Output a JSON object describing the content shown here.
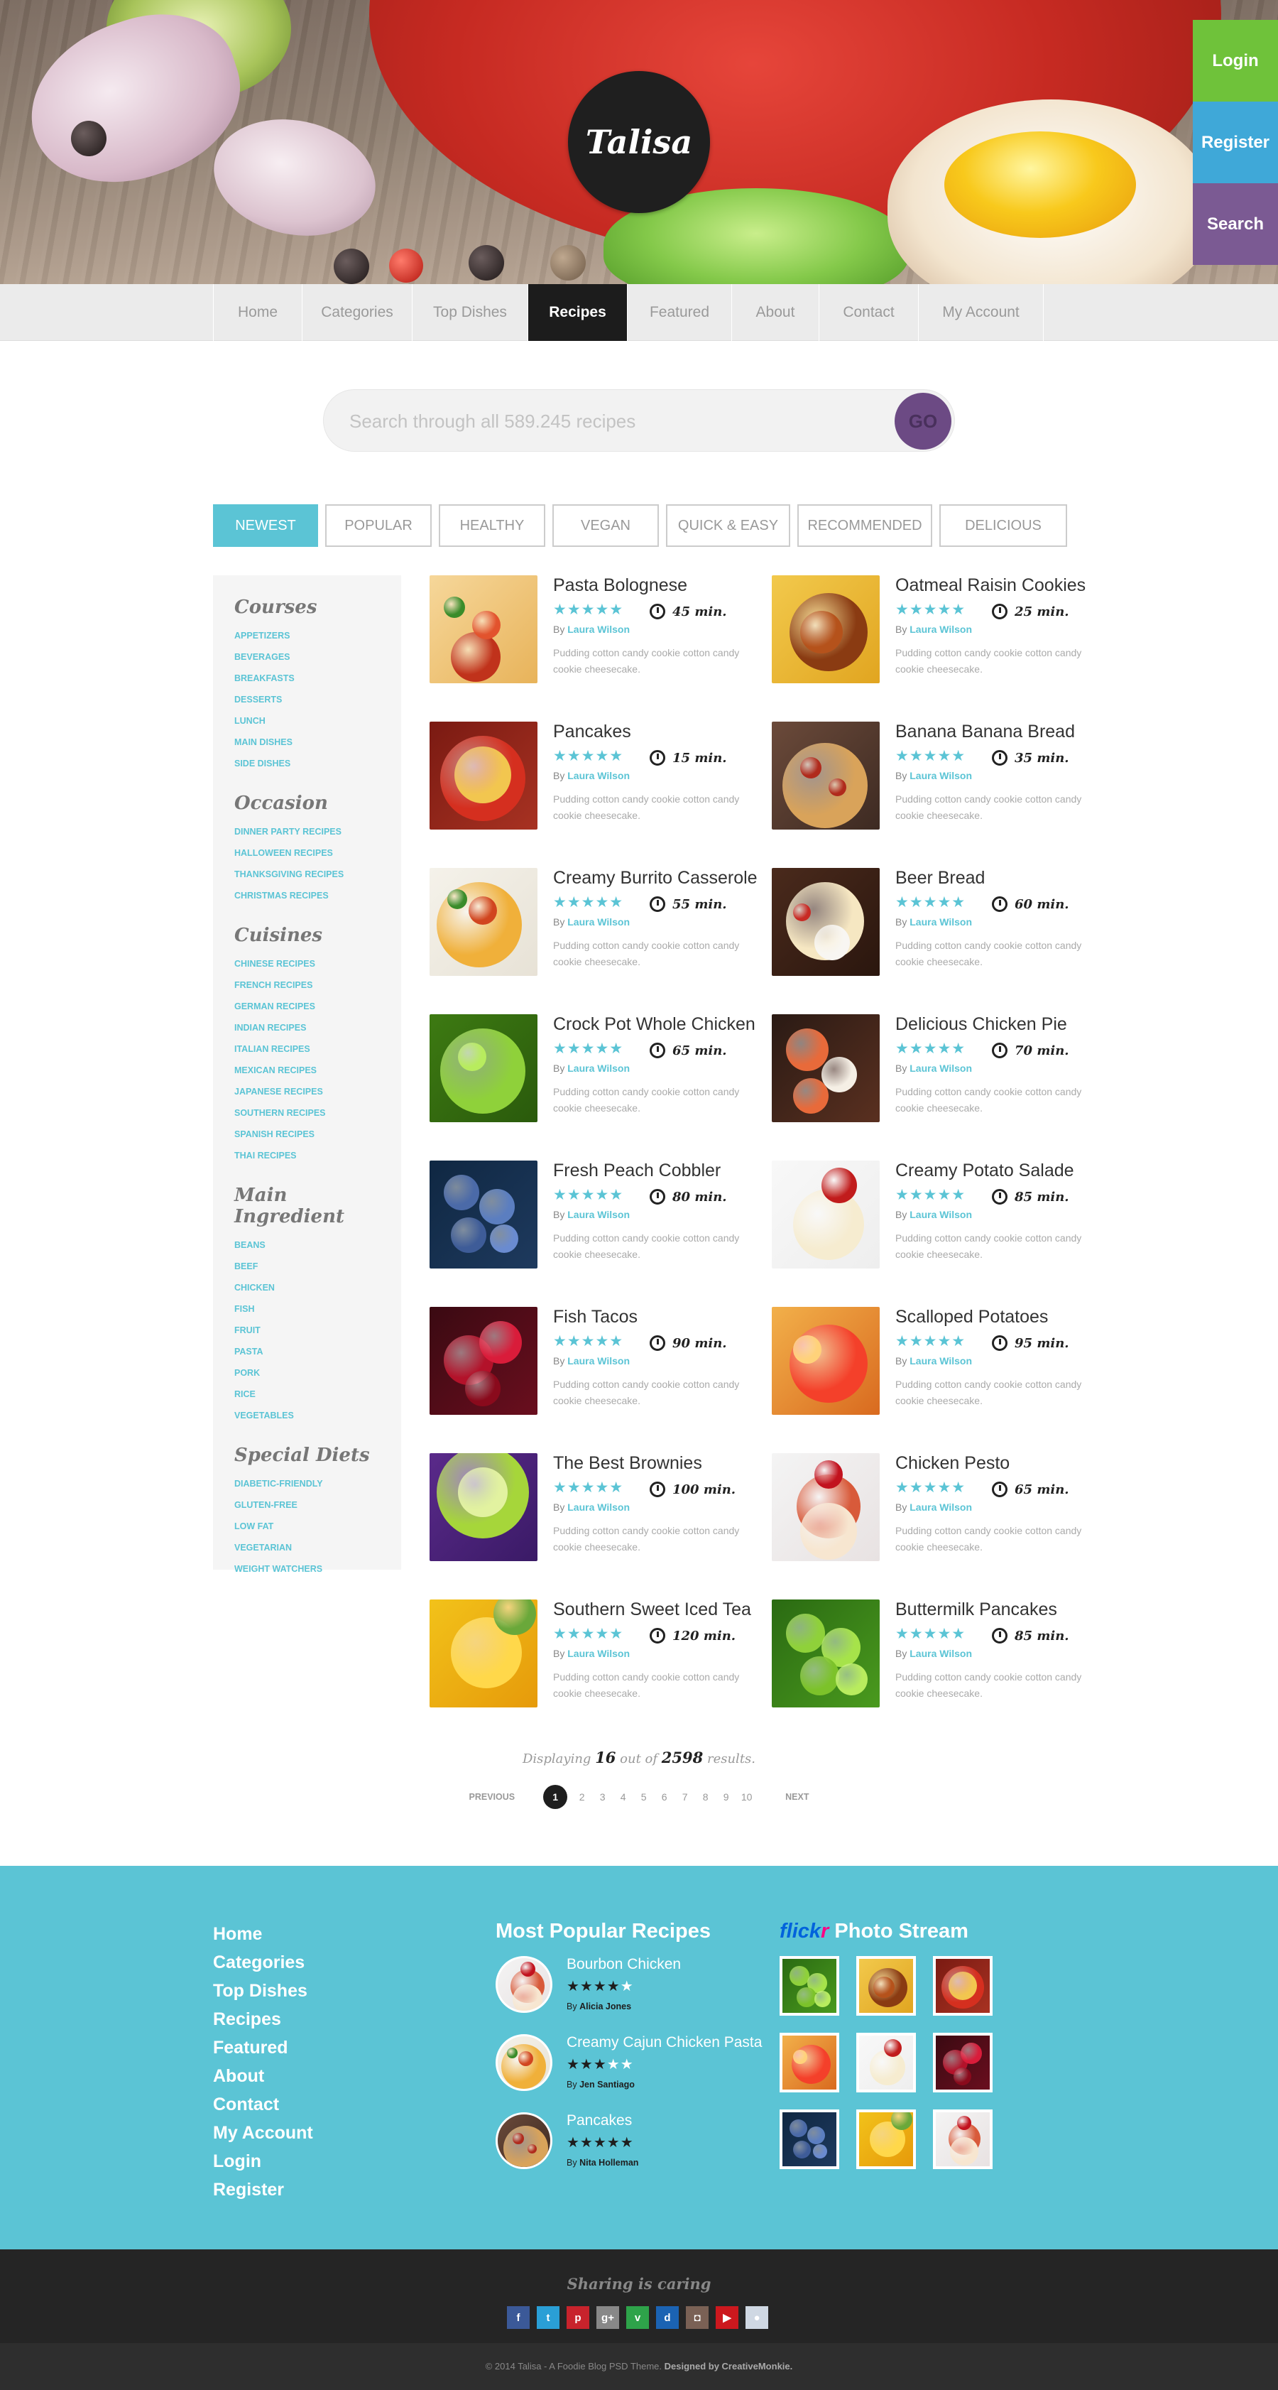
{
  "brand": "Talisa",
  "actions": [
    {
      "label": "Login",
      "color": "#6fc23a"
    },
    {
      "label": "Register",
      "color": "#3fa8d8"
    },
    {
      "label": "Search",
      "color": "#7b5a93"
    }
  ],
  "nav": [
    "Home",
    "Categories",
    "Top Dishes",
    "Recipes",
    "Featured",
    "About",
    "Contact",
    "My Account"
  ],
  "nav_active": "Recipes",
  "search": {
    "placeholder": "Search through all 589.245 recipes",
    "button": "GO"
  },
  "tabs": [
    "NEWEST",
    "POPULAR",
    "HEALTHY",
    "VEGAN",
    "QUICK & EASY",
    "RECOMMENDED",
    "DELICIOUS"
  ],
  "sidebar": [
    {
      "title": "Courses",
      "items": [
        "APPETIZERS",
        "BEVERAGES",
        "BREAKFASTS",
        "DESSERTS",
        "LUNCH",
        "MAIN DISHES",
        "SIDE DISHES"
      ]
    },
    {
      "title": "Occasion",
      "items": [
        "DINNER PARTY RECIPES",
        "HALLOWEEN RECIPES",
        "THANKSGIVING RECIPES",
        "CHRISTMAS RECIPES"
      ]
    },
    {
      "title": "Cuisines",
      "items": [
        "CHINESE RECIPES",
        "FRENCH RECIPES",
        "GERMAN RECIPES",
        "INDIAN RECIPES",
        "ITALIAN RECIPES",
        "MEXICAN RECIPES",
        "JAPANESE RECIPES",
        "SOUTHERN RECIPES",
        "SPANISH RECIPES",
        "THAI RECIPES"
      ]
    },
    {
      "title": "Main Ingredient",
      "items": [
        "BEANS",
        "BEEF",
        "CHICKEN",
        "FISH",
        "FRUIT",
        "PASTA",
        "PORK",
        "RICE",
        "VEGETABLES"
      ]
    },
    {
      "title": "Special Diets",
      "items": [
        "DIABETIC-FRIENDLY",
        "GLUTEN-FREE",
        "LOW FAT",
        "VEGETARIAN",
        "WEIGHT WATCHERS"
      ]
    }
  ],
  "recipe_common": {
    "by_prefix": "By",
    "author": "Laura Wilson",
    "desc": "Pudding cotton candy cookie cotton candy cookie cheesecake.",
    "stars": "★★★★★"
  },
  "recipes": [
    {
      "title": "Pasta Bolognese",
      "time": "45 min.",
      "img": "pasta"
    },
    {
      "title": "Oatmeal Raisin Cookies",
      "time": "25 min.",
      "img": "chicken"
    },
    {
      "title": "Pancakes",
      "time": "15 min.",
      "img": "soup"
    },
    {
      "title": "Banana Banana Bread",
      "time": "35 min.",
      "img": "pizza"
    },
    {
      "title": "Creamy Burrito Casserole",
      "time": "55 min.",
      "img": "spaghetti"
    },
    {
      "title": "Beer Bread",
      "time": "60 min.",
      "img": "cake"
    },
    {
      "title": "Crock Pot Whole Chicken",
      "time": "65 min.",
      "img": "apple"
    },
    {
      "title": "Delicious Chicken Pie",
      "time": "70 min.",
      "img": "sushi"
    },
    {
      "title": "Fresh Peach Cobbler",
      "time": "80 min.",
      "img": "grapes"
    },
    {
      "title": "Creamy Potato Salade",
      "time": "85 min.",
      "img": "cheesecake"
    },
    {
      "title": "Fish Tacos",
      "time": "90 min.",
      "img": "cherries"
    },
    {
      "title": "Scalloped Potatoes",
      "time": "95 min.",
      "img": "peach"
    },
    {
      "title": "The Best Brownies",
      "time": "100 min.",
      "img": "lime"
    },
    {
      "title": "Chicken Pesto",
      "time": "65 min.",
      "img": "strawcake"
    },
    {
      "title": "Southern Sweet Iced Tea",
      "time": "120 min.",
      "img": "corn"
    },
    {
      "title": "Buttermilk Pancakes",
      "time": "85 min.",
      "img": "peas"
    }
  ],
  "pagination": {
    "displaying_prefix": "Displaying",
    "shown": "16",
    "mid": "out of",
    "total": "2598",
    "suffix": "results.",
    "previous": "PREVIOUS",
    "next": "NEXT",
    "pages": [
      "1",
      "2",
      "3",
      "4",
      "5",
      "6",
      "7",
      "8",
      "9",
      "10"
    ],
    "current": "1"
  },
  "footer": {
    "links": [
      "Home",
      "Categories",
      "Top Dishes",
      "Recipes",
      "Featured",
      "About",
      "Contact",
      "My Account",
      "Login",
      "Register"
    ],
    "popular_title": "Most Popular Recipes",
    "popular": [
      {
        "title": "Bourbon Chicken",
        "stars": "★★★★",
        "empty": "★",
        "by": "By",
        "author": "Alicia Jones"
      },
      {
        "title": "Creamy Cajun Chicken Pasta",
        "stars": "★★★",
        "empty": "★★",
        "by": "By",
        "author": "Jen Santiago"
      },
      {
        "title": "Pancakes",
        "stars": "★★★★★",
        "empty": "",
        "by": "By",
        "author": "Nita Holleman"
      }
    ],
    "flickr_a": "flick",
    "flickr_b": "r",
    "flickr_rest": " Photo Stream",
    "sharing": "Sharing is caring",
    "social": [
      {
        "icon": "facebook-icon",
        "glyph": "f",
        "color": "#3b5998"
      },
      {
        "icon": "twitter-icon",
        "glyph": "t",
        "color": "#2a9fd6"
      },
      {
        "icon": "pinterest-icon",
        "glyph": "p",
        "color": "#c8232c"
      },
      {
        "icon": "googleplus-icon",
        "glyph": "g+",
        "color": "#888888"
      },
      {
        "icon": "vine-icon",
        "glyph": "v",
        "color": "#2ea34a"
      },
      {
        "icon": "digg-icon",
        "glyph": "d",
        "color": "#1b63b3"
      },
      {
        "icon": "instagram-icon",
        "glyph": "◘",
        "color": "#7a6155"
      },
      {
        "icon": "youtube-icon",
        "glyph": "▶",
        "color": "#cc181e"
      },
      {
        "icon": "flickr-icon",
        "glyph": "●",
        "color": "#cfd8e3"
      }
    ],
    "copyright": "© 2014 Talisa - A Foodie Blog PSD Theme.",
    "designed_by": "Designed by CreativeMonkie."
  }
}
